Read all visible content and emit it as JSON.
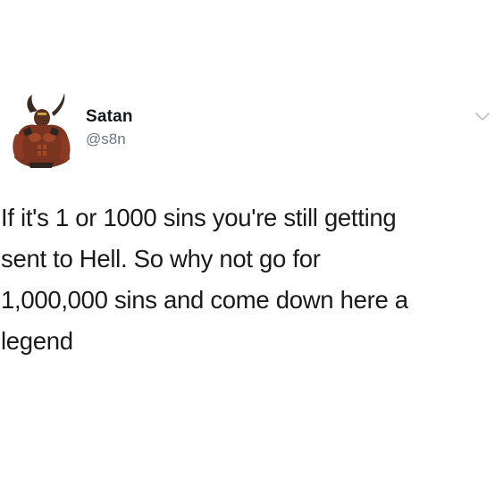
{
  "tweet": {
    "author": {
      "display_name": "Satan",
      "handle": "@s8n",
      "avatar_icon": "horned-demon-avatar-icon"
    },
    "menu_icon": "chevron-down-icon",
    "text": "If it's 1 or 1000 sins you're still getting\nsent to Hell. So why not go for\n1,000,000 sins and come down here a\nlegend"
  },
  "colors": {
    "background": "#ffffff",
    "text": "#1a1a1a",
    "handle": "#6b7680",
    "chevron": "#b8bfc6"
  }
}
